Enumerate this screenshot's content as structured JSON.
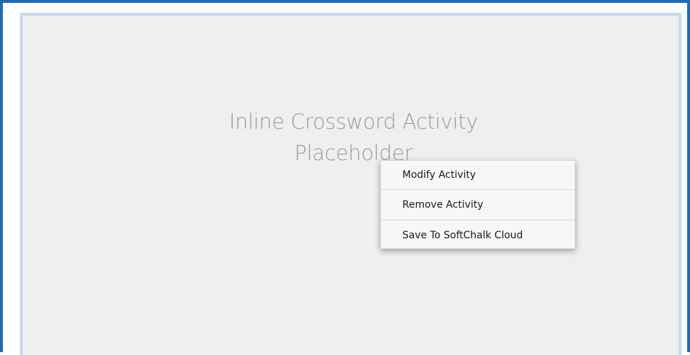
{
  "placeholder": {
    "line1": "Inline Crossword Activity",
    "line2": "Placeholder"
  },
  "context_menu": {
    "items": [
      {
        "label": "Modify Activity"
      },
      {
        "label": "Remove Activity"
      },
      {
        "label": "Save To SoftChalk Cloud"
      }
    ]
  },
  "colors": {
    "frame_border": "#1e6bb8",
    "placeholder_border": "#c5daf0",
    "placeholder_bg": "#efefef",
    "placeholder_text": "#9a9a9a",
    "menu_bg": "#f7f7f7"
  }
}
